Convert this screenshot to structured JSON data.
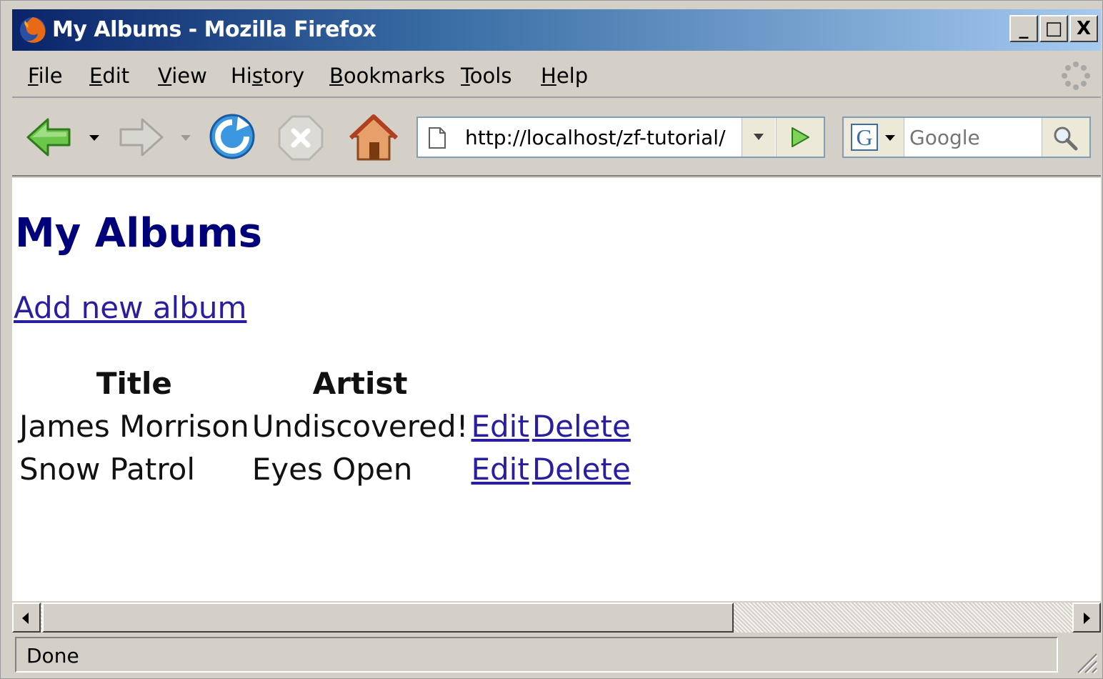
{
  "window": {
    "title": "My Albums - Mozilla Firefox",
    "controls": {
      "minimize": "_",
      "maximize": "□",
      "close": "X"
    }
  },
  "menu": {
    "items": [
      {
        "label": "File",
        "mnemonic": "F"
      },
      {
        "label": "Edit",
        "mnemonic": "E"
      },
      {
        "label": "View",
        "mnemonic": "V"
      },
      {
        "label": "History",
        "mnemonic": "s"
      },
      {
        "label": "Bookmarks",
        "mnemonic": "B"
      },
      {
        "label": "Tools",
        "mnemonic": "T"
      },
      {
        "label": "Help",
        "mnemonic": "H"
      }
    ]
  },
  "toolbar": {
    "icons": [
      "back-arrow-icon",
      "forward-arrow-icon",
      "reload-icon",
      "stop-icon",
      "home-icon"
    ],
    "url": "http://localhost/zf-tutorial/",
    "search_placeholder": "Google",
    "search_engine": "G"
  },
  "page": {
    "heading": "My Albums",
    "add_link": "Add new album",
    "table": {
      "headers": [
        "Title",
        "Artist",
        "",
        ""
      ],
      "rows": [
        {
          "title": "James Morrison",
          "artist": "Undiscovered!",
          "edit": "Edit",
          "delete": "Delete"
        },
        {
          "title": "Snow Patrol",
          "artist": "Eyes Open",
          "edit": "Edit",
          "delete": "Delete"
        }
      ]
    }
  },
  "status": {
    "text": "Done"
  },
  "colors": {
    "title_bar_start": "#0a246a",
    "title_bar_end": "#a6caf0",
    "chrome": "#d4d0c8",
    "heading": "#00007b",
    "link": "#2a1ea0"
  }
}
